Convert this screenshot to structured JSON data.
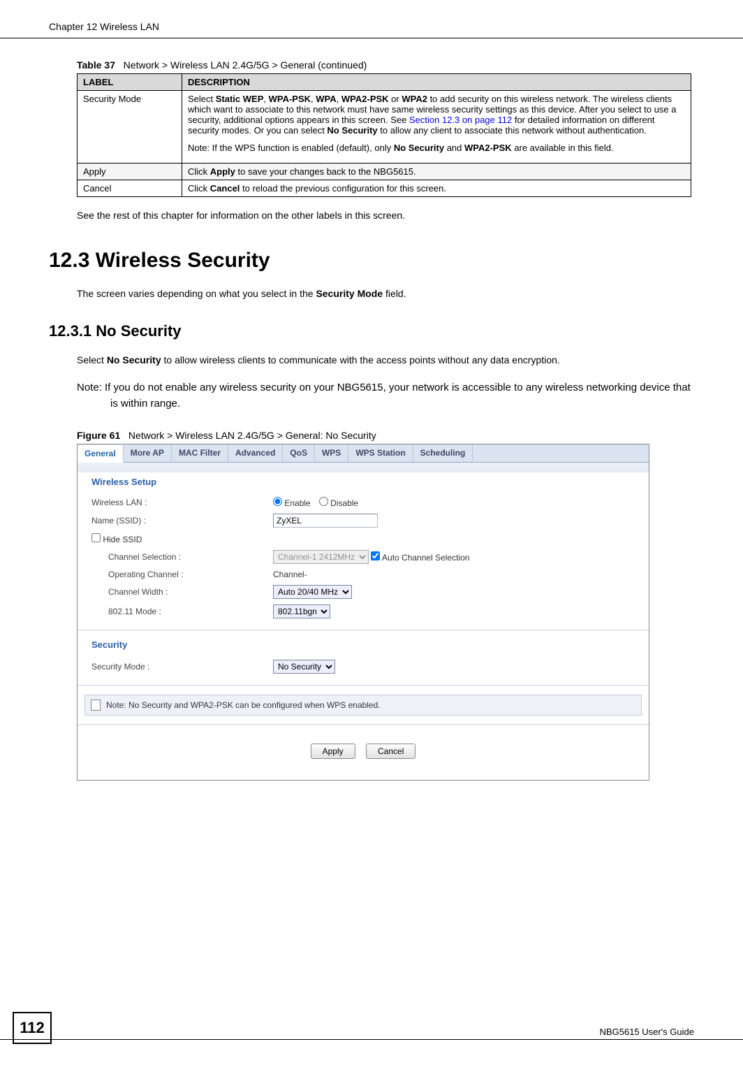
{
  "header": {
    "chapter": "Chapter 12 Wireless LAN"
  },
  "table37": {
    "caption_prefix": "Table 37",
    "caption": "Network > Wireless LAN 2.4G/5G > General (continued)",
    "headers": {
      "label": "LABEL",
      "description": "DESCRIPTION"
    },
    "rows": [
      {
        "label": "Security Mode",
        "desc_p1_a": "Select ",
        "desc_p1_b_bold": "Static WEP",
        "desc_p1_c": ", ",
        "desc_p1_d_bold": "WPA-PSK",
        "desc_p1_e": ", ",
        "desc_p1_f_bold": "WPA",
        "desc_p1_g": ", ",
        "desc_p1_h_bold": "WPA2-PSK",
        "desc_p1_i": " or ",
        "desc_p1_j_bold": "WPA2",
        "desc_p1_k": " to add security on this wireless network. The wireless clients which want to associate to this network must have same wireless security settings as this device. After you select to use a security, additional options appears in this screen. See ",
        "desc_p1_link": "Section 12.3 on page 112",
        "desc_p1_l": " for detailed information on different security modes. Or you can select ",
        "desc_p1_m_bold": "No Security",
        "desc_p1_n": " to allow any client to associate this network without authentication.",
        "desc_p2_a": "Note: If the WPS function is enabled (default), only ",
        "desc_p2_b_bold": "No Security",
        "desc_p2_c": " and ",
        "desc_p2_d_bold": "WPA2-PSK",
        "desc_p2_e": " are available in this field."
      },
      {
        "label": "Apply",
        "desc_a": "Click ",
        "desc_b_bold": "Apply",
        "desc_c": " to save your changes back to the NBG5615."
      },
      {
        "label": "Cancel",
        "desc_a": "Click ",
        "desc_b_bold": "Cancel",
        "desc_c": " to reload the previous configuration for this screen."
      }
    ]
  },
  "after_table_text": "See the rest of this chapter for information on the other labels in this screen.",
  "sec12_3": {
    "heading": "12.3  Wireless Security",
    "intro_a": "The screen varies depending on what you select in the ",
    "intro_b_bold": "Security Mode",
    "intro_c": " field."
  },
  "sec12_3_1": {
    "heading": "12.3.1  No Security",
    "p1_a": "Select ",
    "p1_b_bold": "No Security",
    "p1_c": " to allow wireless clients to communicate with the access points without any data encryption.",
    "note": "Note: If you do not enable any wireless security on your NBG5615, your network is accessible to any wireless networking device that is within range."
  },
  "figure61": {
    "caption_prefix": "Figure 61",
    "caption": "Network > Wireless LAN 2.4G/5G > General: No Security"
  },
  "screenshot": {
    "tabs": [
      "General",
      "More AP",
      "MAC Filter",
      "Advanced",
      "QoS",
      "WPS",
      "WPS Station",
      "Scheduling"
    ],
    "active_tab": 0,
    "wireless_setup_title": "Wireless Setup",
    "labels": {
      "wlan": "Wireless LAN :",
      "enable": "Enable",
      "disable": "Disable",
      "ssid": "Name (SSID) :",
      "ssid_value": "ZyXEL",
      "hide_ssid": "Hide SSID",
      "channel_sel": "Channel Selection :",
      "channel_sel_value": "Channel-1 2412MHz",
      "auto_channel": "Auto Channel Selection",
      "op_channel": "Operating Channel :",
      "op_channel_value": "Channel-",
      "ch_width": "Channel Width :",
      "ch_width_value": "Auto 20/40 MHz",
      "mode_80211": "802.11 Mode :",
      "mode_80211_value": "802.11bgn"
    },
    "security_title": "Security",
    "sec_mode_label": "Security Mode :",
    "sec_mode_value": "No Security",
    "note_text": "Note: No Security and WPA2-PSK can be configured when WPS enabled.",
    "apply_btn": "Apply",
    "cancel_btn": "Cancel"
  },
  "footer": {
    "page_number": "112",
    "guide": "NBG5615 User's Guide"
  }
}
